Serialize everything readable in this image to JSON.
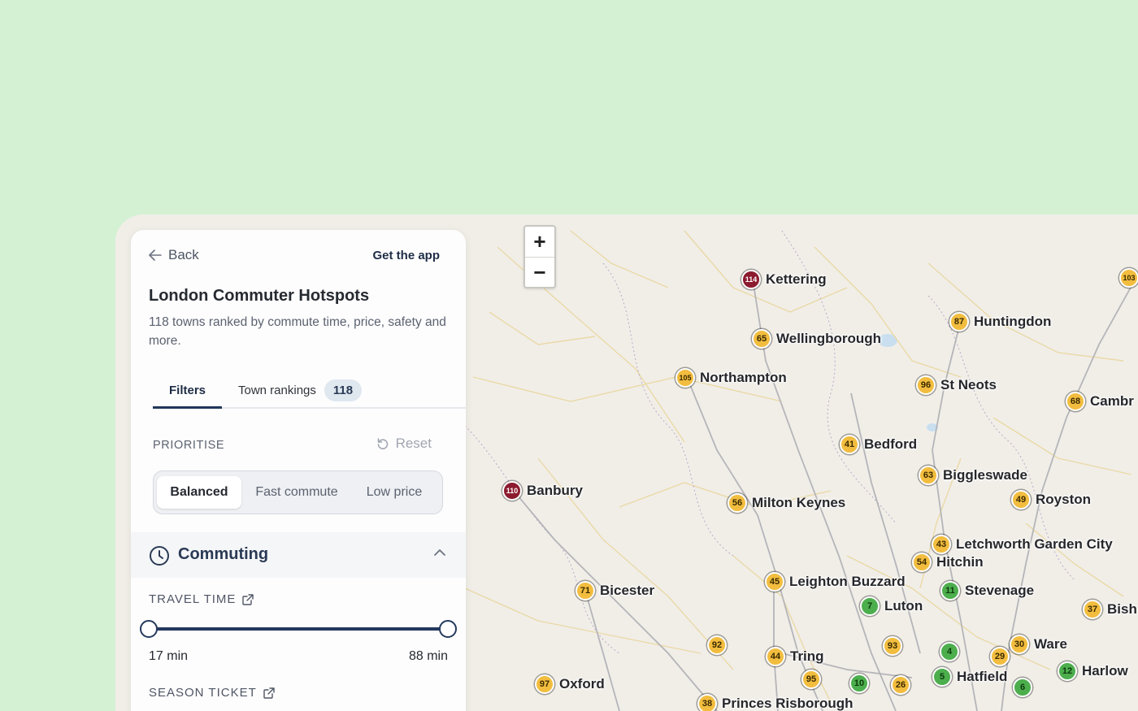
{
  "panel": {
    "back_label": "Back",
    "get_app_label": "Get the app",
    "title": "London Commuter Hotspots",
    "description": "118 towns ranked by commute time, price, safety and more.",
    "tabs": [
      {
        "label": "Filters",
        "active": true
      },
      {
        "label": "Town rankings",
        "badge": "118",
        "active": false
      }
    ],
    "prioritise": {
      "label": "PRIORITISE",
      "reset_label": "Reset",
      "options": [
        "Balanced",
        "Fast commute",
        "Low price"
      ],
      "selected": "Balanced"
    },
    "commuting": {
      "title": "Commuting",
      "travel_time": {
        "label": "TRAVEL TIME",
        "min_label": "17 min",
        "max_label": "88 min",
        "min": 17,
        "max": 88
      },
      "season_ticket": {
        "label": "SEASON TICKET"
      }
    }
  },
  "map": {
    "zoom_in": "+",
    "zoom_out": "−",
    "colors": {
      "yellow": "#f2bd3f",
      "green": "#4cae4c",
      "red": "#8c1b2f",
      "background": "#d4f1d4"
    },
    "markers": [
      {
        "rank": "114",
        "name": "Kettering",
        "color": "red"
      },
      {
        "rank": "65",
        "name": "Wellingborough",
        "color": "yellow"
      },
      {
        "rank": "105",
        "name": "Northampton",
        "color": "yellow"
      },
      {
        "rank": "87",
        "name": "Huntingdon",
        "color": "yellow"
      },
      {
        "rank": "96",
        "name": "St Neots",
        "color": "yellow"
      },
      {
        "rank": "68",
        "name": "Cambr",
        "color": "yellow"
      },
      {
        "rank": "103",
        "name": "",
        "color": "yellow"
      },
      {
        "rank": "41",
        "name": "Bedford",
        "color": "yellow"
      },
      {
        "rank": "63",
        "name": "Biggleswade",
        "color": "yellow"
      },
      {
        "rank": "110",
        "name": "Banbury",
        "color": "red"
      },
      {
        "rank": "56",
        "name": "Milton Keynes",
        "color": "yellow"
      },
      {
        "rank": "49",
        "name": "Royston",
        "color": "yellow"
      },
      {
        "rank": "43",
        "name": "Letchworth Garden City",
        "color": "yellow"
      },
      {
        "rank": "54",
        "name": "Hitchin",
        "color": "yellow"
      },
      {
        "rank": "71",
        "name": "Bicester",
        "color": "yellow"
      },
      {
        "rank": "45",
        "name": "Leighton Buzzard",
        "color": "yellow"
      },
      {
        "rank": "11",
        "name": "Stevenage",
        "color": "green"
      },
      {
        "rank": "7",
        "name": "Luton",
        "color": "green"
      },
      {
        "rank": "37",
        "name": "Bish",
        "color": "yellow"
      },
      {
        "rank": "92",
        "name": "",
        "color": "yellow"
      },
      {
        "rank": "44",
        "name": "Tring",
        "color": "yellow"
      },
      {
        "rank": "93",
        "name": "",
        "color": "yellow"
      },
      {
        "rank": "4",
        "name": "",
        "color": "green"
      },
      {
        "rank": "30",
        "name": "Ware",
        "color": "yellow"
      },
      {
        "rank": "29",
        "name": "",
        "color": "yellow"
      },
      {
        "rank": "5",
        "name": "Hatfield",
        "color": "green"
      },
      {
        "rank": "12",
        "name": "Harlow",
        "color": "green"
      },
      {
        "rank": "97",
        "name": "Oxford",
        "color": "yellow"
      },
      {
        "rank": "95",
        "name": "",
        "color": "yellow"
      },
      {
        "rank": "10",
        "name": "",
        "color": "green"
      },
      {
        "rank": "26",
        "name": "",
        "color": "yellow"
      },
      {
        "rank": "6",
        "name": "",
        "color": "green"
      },
      {
        "rank": "38",
        "name": "Princes Risborough",
        "color": "yellow"
      }
    ]
  }
}
